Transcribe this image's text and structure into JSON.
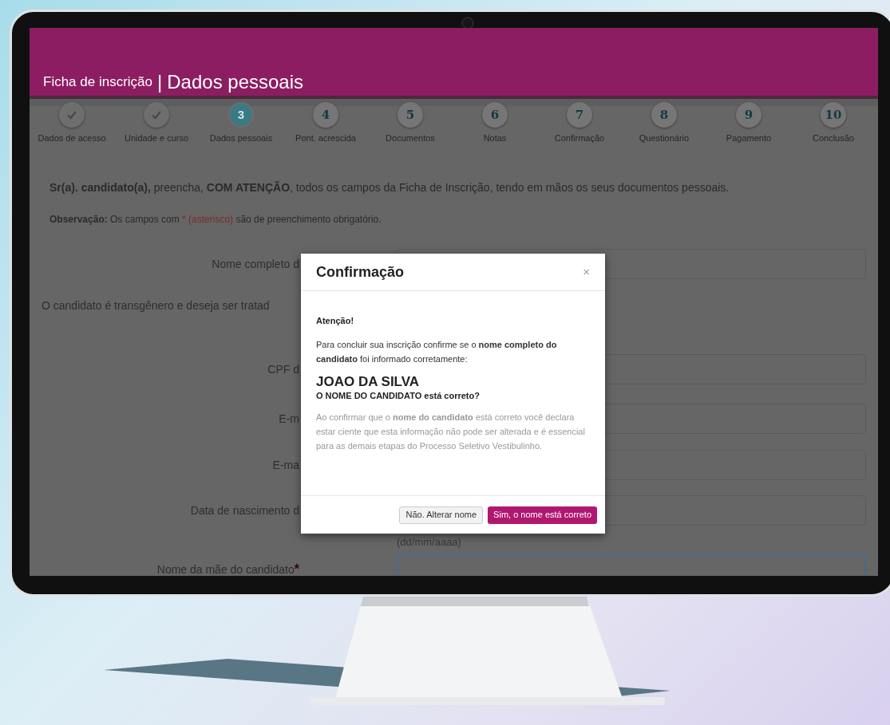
{
  "header": {
    "form_label": "Ficha de inscrição",
    "separator": "|",
    "section_title": "Dados pessoais"
  },
  "steps": [
    {
      "label": "Dados de acesso",
      "done": true,
      "selected": false
    },
    {
      "label": "Unidade e curso",
      "done": true,
      "selected": false
    },
    {
      "number": "3",
      "label": "Dados pessoais",
      "done": false,
      "selected": true
    },
    {
      "number": "4",
      "label": "Pont. acrescida",
      "done": false,
      "selected": false
    },
    {
      "number": "5",
      "label": "Documentos",
      "done": false,
      "selected": false
    },
    {
      "number": "6",
      "label": "Notas",
      "done": false,
      "selected": false
    },
    {
      "number": "7",
      "label": "Confirmação",
      "done": false,
      "selected": false
    },
    {
      "number": "8",
      "label": "Questionário",
      "done": false,
      "selected": false
    },
    {
      "number": "9",
      "label": "Pagamento",
      "done": false,
      "selected": false
    },
    {
      "number": "10",
      "label": "Conclusão",
      "done": false,
      "selected": false
    }
  ],
  "intro": "**Sr(a). candidato(a),** preencha, **COM ATENÇÃO**, todos os campos da Ficha de Inscrição, tendo em mãos os seus documentos pessoais.",
  "observation": {
    "before": "**Observação:** Os campos com ",
    "highlight": "* (asterisco)",
    "after": " são de preenchimento obrigatório."
  },
  "fields": [
    {
      "kind": "input",
      "label": "Nome completo d",
      "focused": false
    },
    {
      "kind": "note",
      "label": "O candidato é transgênero e deseja ser tratad"
    },
    {
      "kind": "input",
      "label": "CPF d",
      "focused": false
    },
    {
      "kind": "input",
      "label": "E-m",
      "focused": false
    },
    {
      "kind": "input",
      "label": "E-ma",
      "focused": false
    },
    {
      "kind": "input",
      "label": "Data de nascimento d",
      "hint": "(dd/mm/aaaa)",
      "focused": false
    },
    {
      "kind": "input",
      "label": "Nome da mãe do candidato",
      "required_mark": "*",
      "focused": true
    }
  ],
  "dialog": {
    "title": "Confirmação",
    "close": "×",
    "heading": "Atenção!",
    "message": "Para concluir sua inscrição confirme se o **nome completo do candidato** foi informado corretamente:",
    "name": "JOAO DA SILVA",
    "question": "O NOME DO CANDIDATO está correto?",
    "note": "Ao confirmar que o **nome do candidato** está correto você declara estar ciente que esta informação não pode ser alterada e é essencial para as demais etapas do Processo Seletivo Vestibulinho.",
    "buttons": [
      {
        "label": "Não. Alterar nome",
        "kind": "secondary"
      },
      {
        "label": "Sim, o nome está correto",
        "kind": "primary"
      }
    ]
  }
}
